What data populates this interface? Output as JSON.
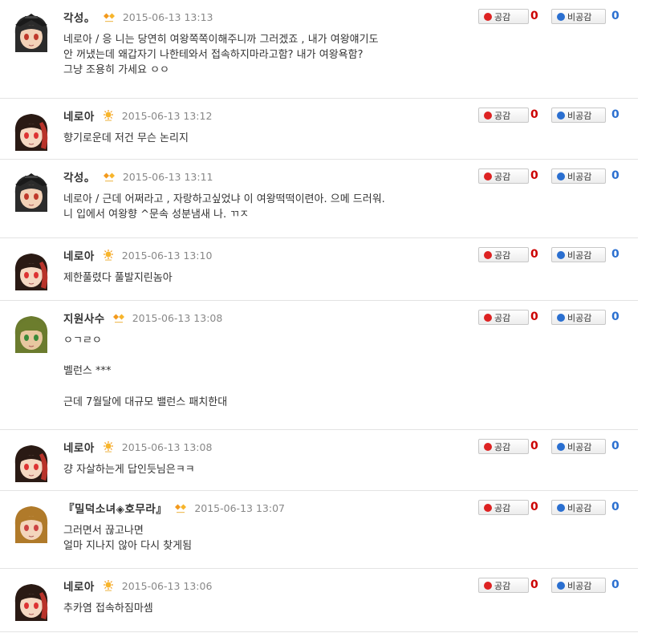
{
  "colors": {
    "like": "#cc0000",
    "dislike": "#2a6fd0"
  },
  "comments": [
    {
      "nick": "각성。",
      "badge": "diamond-badge-icon",
      "date": "2015-06-13 13:13",
      "lines": [
        "네로아 / 응 니는 당연히 여왕쪽쪽이해주니까 그러겠죠 , 내가 여왕얘기도",
        "안 꺼냈는데 왜갑자기 나한테와서 접속하지마라고함? 내가 여왕욕함?",
        "그냥 조용히 가세요 ㅇㅇ"
      ],
      "like_label": "공감",
      "like_count": "0",
      "dislike_label": "비공감",
      "dislike_count": "0"
    },
    {
      "nick": "네로아",
      "badge": "sun-badge-icon",
      "date": "2015-06-13 13:12",
      "lines": [
        "향기로운데 저건 무슨 논리지"
      ],
      "like_label": "공감",
      "like_count": "0",
      "dislike_label": "비공감",
      "dislike_count": "0"
    },
    {
      "nick": "각성。",
      "badge": "diamond-badge-icon",
      "date": "2015-06-13 13:11",
      "lines": [
        "네로아 / 근데 어쩌라고 , 자랑하고싶었냐 이 여왕떡떡이련아. 으메 드러워.",
        "니 입에서 여왕향 ^문속 성분냄새 나. ㄲㅈ"
      ],
      "like_label": "공감",
      "like_count": "0",
      "dislike_label": "비공감",
      "dislike_count": "0"
    },
    {
      "nick": "네로아",
      "badge": "sun-badge-icon",
      "date": "2015-06-13 13:10",
      "lines": [
        "제한풀렸다 풀발지린놈아"
      ],
      "like_label": "공감",
      "like_count": "0",
      "dislike_label": "비공감",
      "dislike_count": "0"
    },
    {
      "nick": "지원사수",
      "badge": "diamond-badge-icon",
      "date": "2015-06-13 13:08",
      "lines": [
        "ㅇㄱㄹㅇ",
        "",
        "벨런스 ***",
        "",
        "근데 7월달에 대규모 밸런스 패치한대"
      ],
      "like_label": "공감",
      "like_count": "0",
      "dislike_label": "비공감",
      "dislike_count": "0"
    },
    {
      "nick": "네로아",
      "badge": "sun-badge-icon",
      "date": "2015-06-13 13:08",
      "lines": [
        "걍 자살하는게 답인듯님은ㅋㅋ"
      ],
      "like_label": "공감",
      "like_count": "0",
      "dislike_label": "비공감",
      "dislike_count": "0"
    },
    {
      "nick": "『밀덕소녀◈호무라』",
      "badge": "diamond-badge-icon",
      "date": "2015-06-13 13:07",
      "lines": [
        "그러면서 끊고나면",
        "얼마 지나지 않아 다시 찾게됨"
      ],
      "like_label": "공감",
      "like_count": "0",
      "dislike_label": "비공감",
      "dislike_count": "0"
    },
    {
      "nick": "네로아",
      "badge": "sun-badge-icon",
      "date": "2015-06-13 13:06",
      "lines": [
        "추카염 접속하짐마셈"
      ],
      "like_label": "공감",
      "like_count": "0",
      "dislike_label": "비공감",
      "dislike_count": "0"
    }
  ]
}
